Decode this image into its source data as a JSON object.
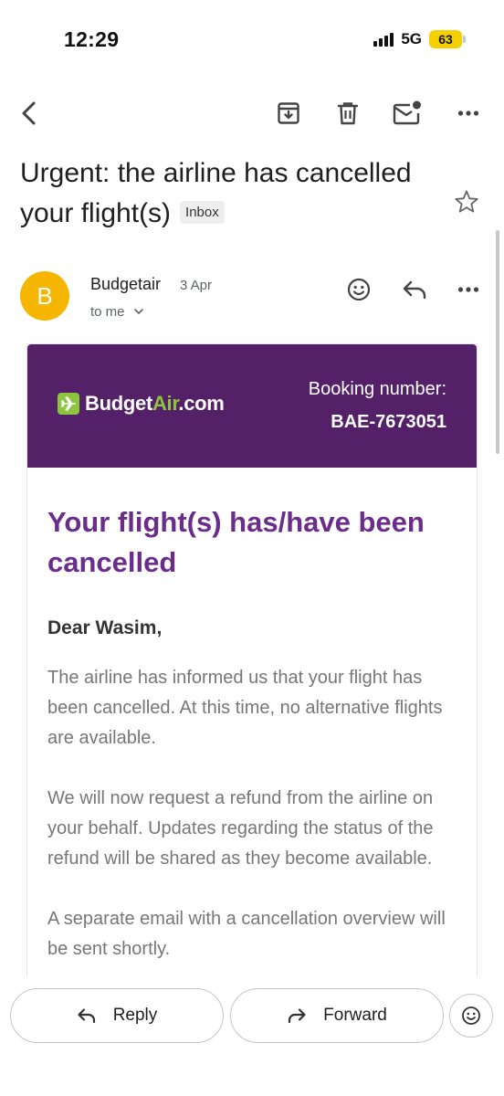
{
  "status_bar": {
    "time": "12:29",
    "network": "5G",
    "battery": "63"
  },
  "toolbar": {
    "icons": [
      "back-arrow-icon",
      "archive-icon",
      "trash-icon",
      "mark-unread-icon",
      "more-vert-icon"
    ]
  },
  "email": {
    "subject": "Urgent: the airline has cancelled your flight(s)",
    "label": "Inbox",
    "sender": {
      "avatar_letter": "B",
      "name": "Budgetair",
      "date": "3 Apr",
      "recipient": "to me"
    }
  },
  "message": {
    "logo": {
      "text_main": "BudgetAir",
      "text_suffix": ".com"
    },
    "booking_label": "Booking number:",
    "booking_number": "BAE-7673051",
    "headline": "Your flight(s) has/have been cancelled",
    "greeting": "Dear Wasim,",
    "paragraphs": [
      "The airline has informed us that your flight has been cancelled. At this time, no alternative flights are available.",
      "We will now request a refund from the airline on your behalf. Updates regarding the status of the refund will be shared as they become available.",
      "A separate email with a cancellation overview will be sent shortly."
    ]
  },
  "actions": {
    "reply": "Reply",
    "forward": "Forward"
  },
  "colors": {
    "banner": "#542169",
    "headline": "#6a2d8c",
    "avatar": "#f6b500",
    "logo_accent": "#8cc63f",
    "battery": "#f5d000"
  }
}
